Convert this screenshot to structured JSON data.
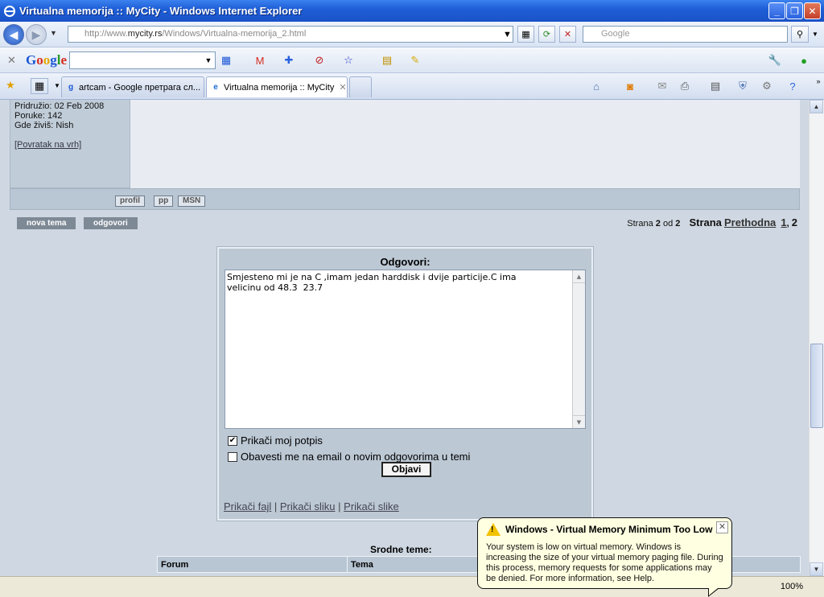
{
  "window": {
    "title": "Virtualna memorija :: MyCity - Windows Internet Explorer"
  },
  "address": {
    "prefix": "http://www.",
    "host": "mycity.rs",
    "path": "/Windows/Virtualna-memorija_2.html",
    "search_placeholder": "Google"
  },
  "google_toolbar": {
    "logo": "Google"
  },
  "tabs": [
    {
      "label": "artcam - Google претрага сл..."
    },
    {
      "label": "Virtualna memorija :: MyCity"
    }
  ],
  "user_panel": {
    "joined": "Pridružio: 02 Feb 2008",
    "posts": "Poruke: 142",
    "location": "Gde živiš: Nish",
    "back_to_top": "[Povratak na vrh]"
  },
  "post_buttons": {
    "profile": "profil",
    "pm": "pp",
    "msn": "MSN"
  },
  "actions": {
    "new_topic": "nova tema",
    "reply": "odgovori"
  },
  "pagination": {
    "page_label": "Strana",
    "current": "2",
    "of": "od",
    "total": "2",
    "strana": "Strana",
    "prev": "Prethodna",
    "p1": "1",
    "sep": ",",
    "p2": "2"
  },
  "reply": {
    "header": "Odgovori:",
    "message": "Smjesteno mi je na C ,imam jedan harddisk i dvije particije.C ima\nvelicinu od 48.3  23.7",
    "attach_signature": "Prikači moj potpis",
    "notify_email": "Obavesti me na email o novim odgovorima u temi",
    "submit": "Objavi",
    "attach_file": "Prikači fajl",
    "attach_image": "Prikači sliku",
    "attach_images": "Prikači slike",
    "separator": "|"
  },
  "related": {
    "title": "Srodne teme:",
    "col_forum": "Forum",
    "col_topic": "Tema"
  },
  "status": {
    "zoom": "100%"
  },
  "balloon": {
    "title": "Windows - Virtual Memory Minimum Too Low",
    "body": "Your system is low on virtual memory. Windows is increasing the size of your virtual memory paging file. During this process, memory requests for some applications may be denied. For more information, see Help."
  }
}
